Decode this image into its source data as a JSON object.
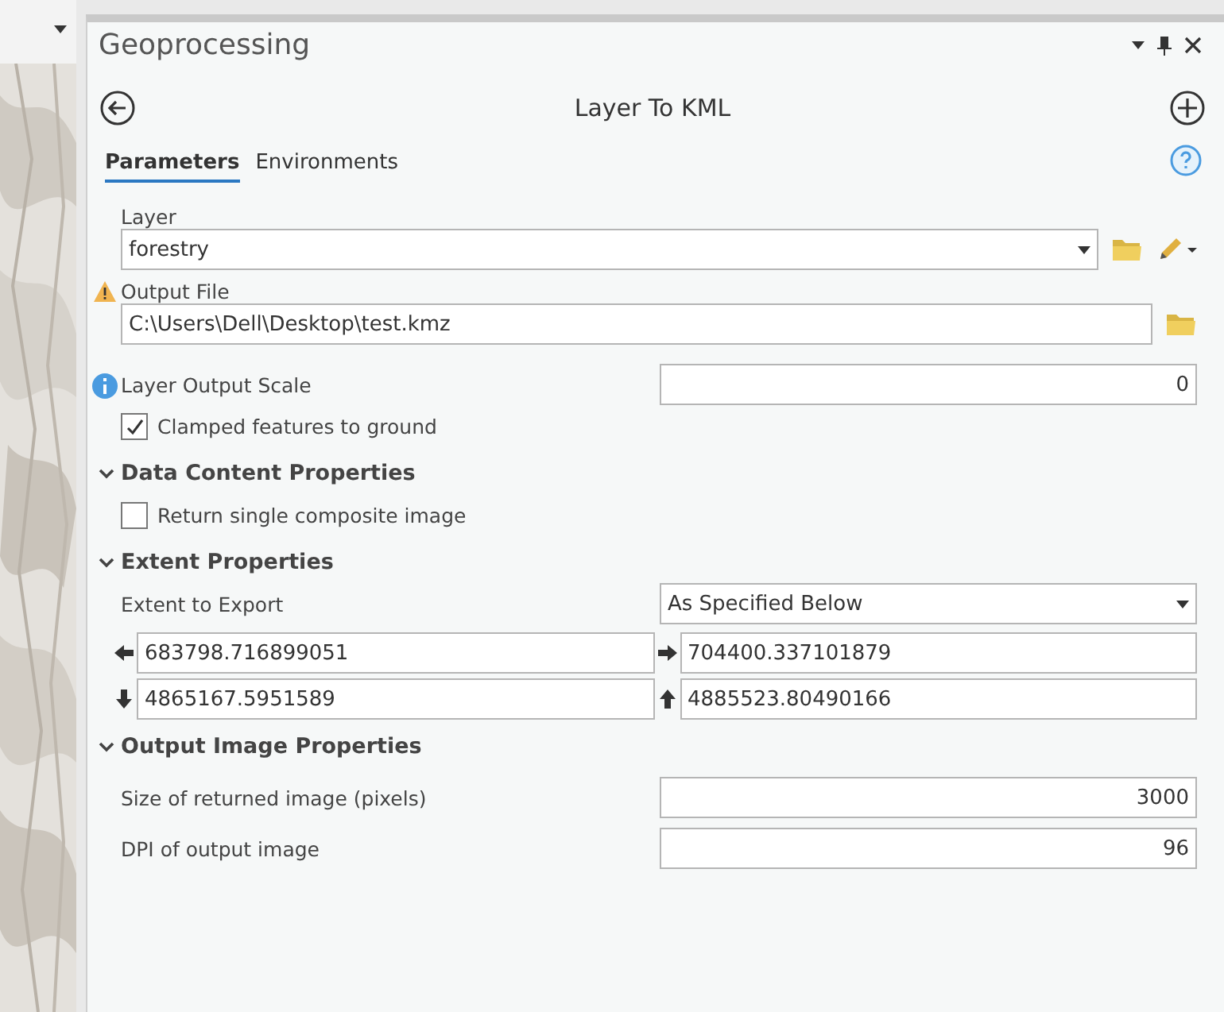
{
  "panel": {
    "title": "Geoprocessing"
  },
  "tool": {
    "title": "Layer To KML"
  },
  "tabs": [
    {
      "label": "Parameters",
      "selected": true
    },
    {
      "label": "Environments",
      "selected": false
    }
  ],
  "rows": [
    {
      "kind": "combo",
      "label": "Layer",
      "value": "forestry"
    },
    {
      "kind": "file",
      "label": "Output File",
      "status": {
        "kind": "warning"
      },
      "value": "C:\\Users\\Dell\\Desktop\\test.kmz"
    },
    {
      "kind": "inline",
      "label": "Layer Output Scale",
      "status": {
        "kind": "info"
      },
      "value": "0"
    },
    {
      "kind": "checkbox",
      "label": "Clamped features to ground",
      "checked": true
    },
    {
      "kind": "section",
      "label": "Data Content Properties",
      "expanded": true
    },
    {
      "kind": "checkbox",
      "label": "Return single composite image",
      "checked": false
    },
    {
      "kind": "section",
      "label": "Extent Properties",
      "expanded": true
    },
    {
      "kind": "select",
      "label": "Extent to Export",
      "value": "As Specified Below"
    },
    {
      "kind": "extent",
      "values": [
        {
          "kind": "left",
          "value": "683798.716899051"
        },
        {
          "kind": "right",
          "value": "704400.337101879"
        },
        {
          "kind": "down",
          "value": "4865167.5951589"
        },
        {
          "kind": "up",
          "value": "4885523.80490166"
        }
      ]
    },
    {
      "kind": "section",
      "label": "Output Image Properties",
      "expanded": true
    },
    {
      "kind": "inline",
      "label": "Size of returned image (pixels)",
      "value": "3000"
    },
    {
      "kind": "inline",
      "label": "DPI of output image",
      "value": "96"
    }
  ]
}
